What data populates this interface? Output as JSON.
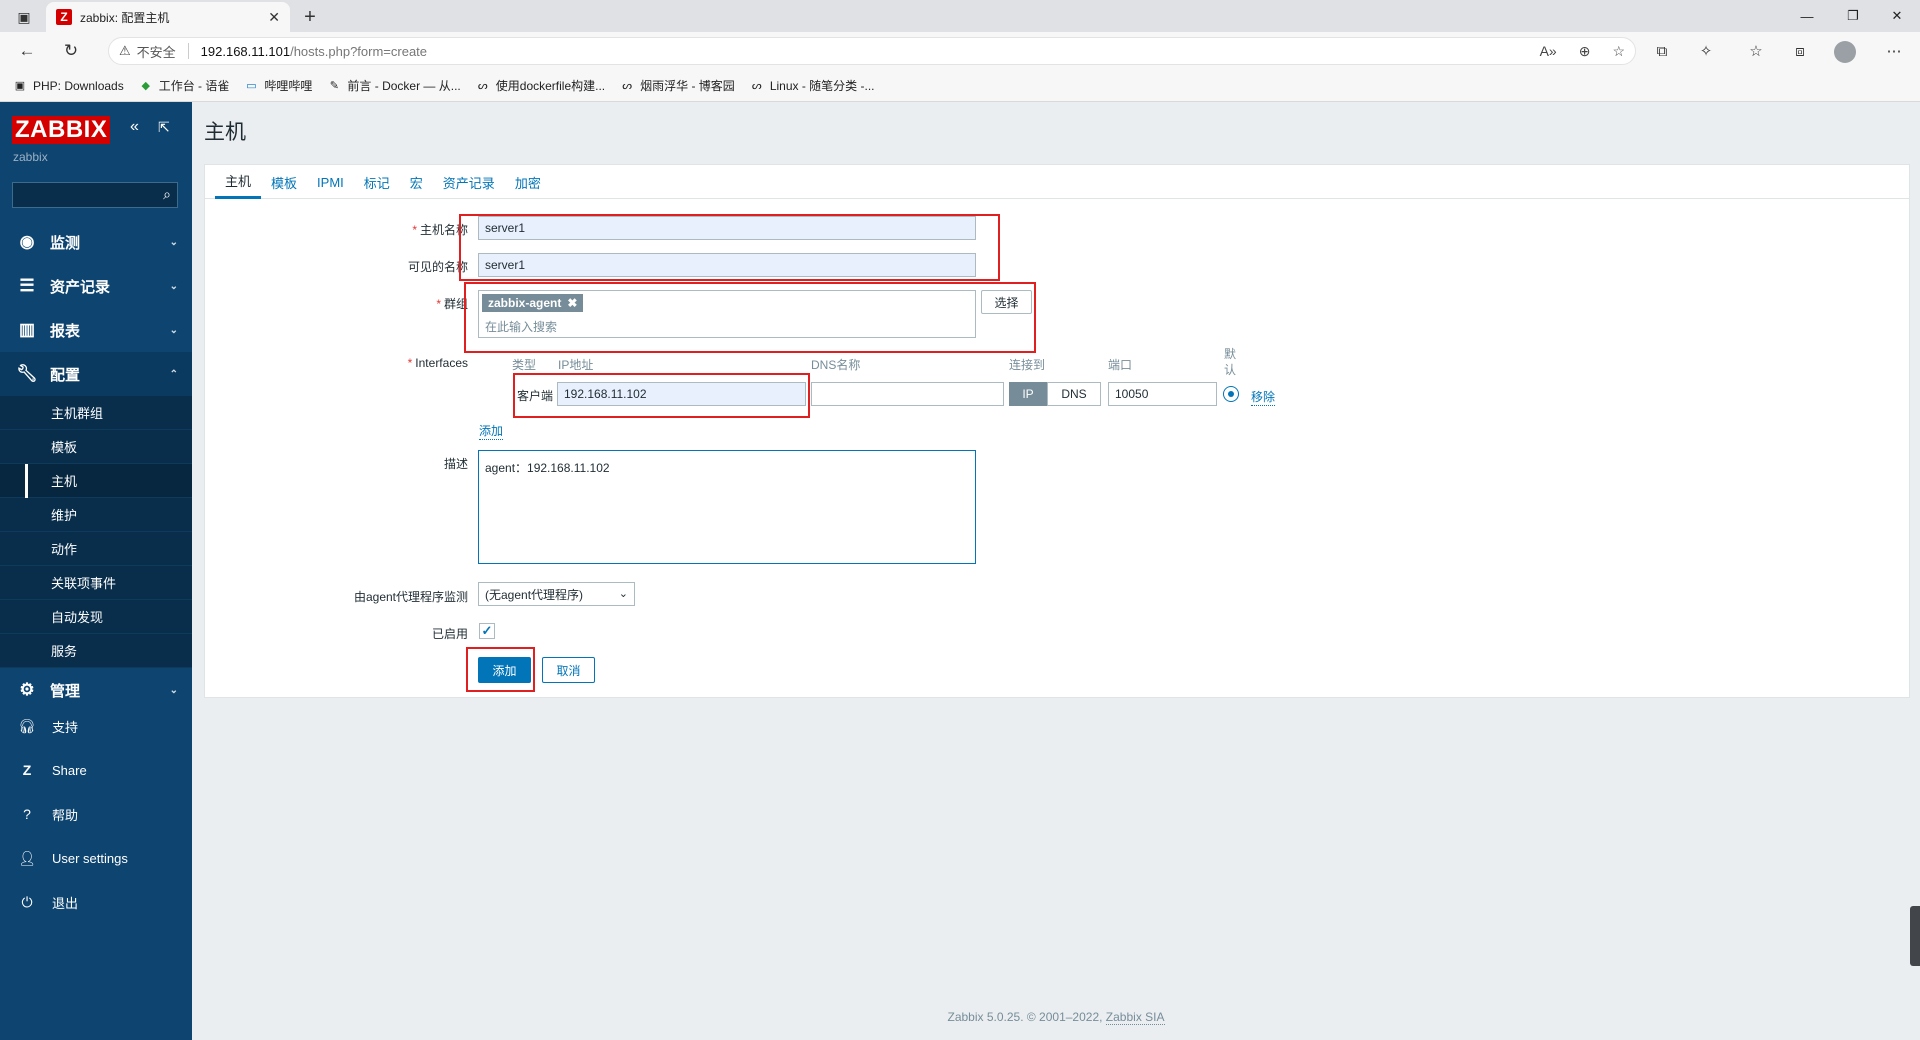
{
  "browser": {
    "tab_title": "zabbix: 配置主机",
    "insecure_label": "不安全",
    "url_host": "192.168.11.101",
    "url_path": "/hosts.php?form=create",
    "bookmarks": [
      {
        "label": "PHP: Downloads",
        "icon": "php-icon"
      },
      {
        "label": "工作台 - 语雀",
        "icon": "yuque-icon"
      },
      {
        "label": "哔哩哔哩",
        "icon": "bilibili-icon"
      },
      {
        "label": "前言 - Docker — 从...",
        "icon": "docker-icon"
      },
      {
        "label": "使用dockerfile构建...",
        "icon": "cnblogs-icon"
      },
      {
        "label": "烟雨浮华 - 博客园",
        "icon": "cnblogs-icon"
      },
      {
        "label": "Linux - 随笔分类 -...",
        "icon": "cnblogs-icon"
      }
    ]
  },
  "sidebar": {
    "logo": "ZABBIX",
    "server_name": "zabbix",
    "menu": [
      {
        "label": "监测",
        "icon": "eye-icon"
      },
      {
        "label": "资产记录",
        "icon": "list-icon"
      },
      {
        "label": "报表",
        "icon": "chart-icon"
      },
      {
        "label": "配置",
        "icon": "wrench-icon"
      },
      {
        "label": "管理",
        "icon": "cog-icon"
      }
    ],
    "submenu": [
      "主机群组",
      "模板",
      "主机",
      "维护",
      "动作",
      "关联项事件",
      "自动发现",
      "服务"
    ],
    "bottom": [
      {
        "label": "支持",
        "icon": "headset-icon"
      },
      {
        "label": "Share",
        "icon": "share-icon"
      },
      {
        "label": "帮助",
        "icon": "help-icon"
      },
      {
        "label": "User settings",
        "icon": "user-icon"
      },
      {
        "label": "退出",
        "icon": "power-icon"
      }
    ]
  },
  "page": {
    "title": "主机",
    "tabs": [
      "主机",
      "模板",
      "IPMI",
      "标记",
      "宏",
      "资产记录",
      "加密"
    ]
  },
  "form": {
    "host_name_label": "主机名称",
    "host_name_value": "server1",
    "visible_name_label": "可见的名称",
    "visible_name_value": "server1",
    "groups_label": "群组",
    "group_chip": "zabbix-agent",
    "groups_placeholder": "在此输入搜索",
    "select_button": "选择",
    "interfaces_label": "Interfaces",
    "iface_headers": {
      "type": "类型",
      "ip": "IP地址",
      "dns": "DNS名称",
      "connect": "连接到",
      "port": "端口",
      "default": "默认"
    },
    "iface_type": "客户端",
    "iface_ip": "192.168.11.102",
    "iface_dns": "",
    "iface_ip_btn": "IP",
    "iface_dns_btn": "DNS",
    "iface_port": "10050",
    "iface_remove": "移除",
    "add_interface": "添加",
    "description_label": "描述",
    "description_value": "agent：192.168.11.102",
    "proxy_label": "由agent代理程序监测",
    "proxy_value": "(无agent代理程序)",
    "enabled_label": "已启用",
    "enabled": true,
    "add_button": "添加",
    "cancel_button": "取消"
  },
  "footer": {
    "text": "Zabbix 5.0.25. © 2001–2022, ",
    "link": "Zabbix SIA"
  }
}
